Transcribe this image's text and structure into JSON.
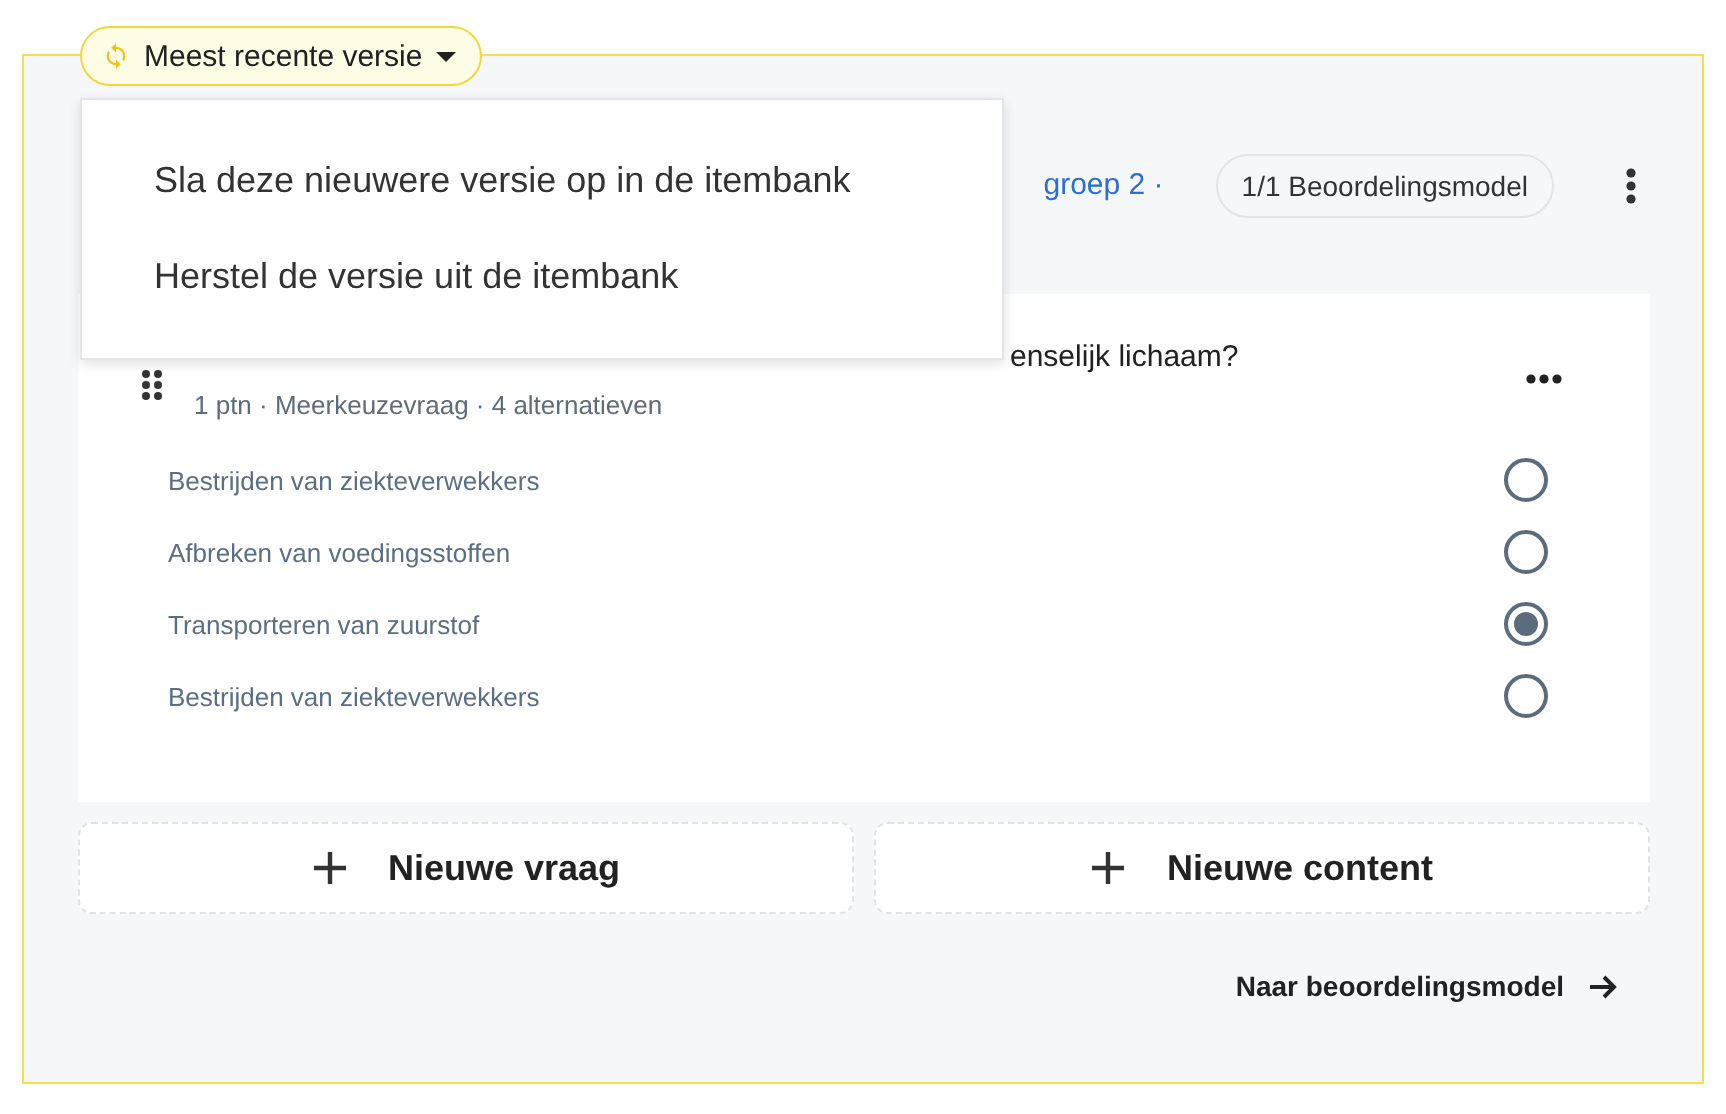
{
  "version_selector": {
    "label": "Meest recente versie",
    "open": true
  },
  "version_menu": {
    "items": [
      "Sla deze nieuwere versie op in de itembank",
      "Herstel de versie uit de itembank"
    ]
  },
  "header": {
    "breadcrumb": "groep 2 ·",
    "rubric_badge": "1/1 Beoordelingsmodel"
  },
  "question": {
    "text": "enselijk lichaam?",
    "meta": "1 ptn · Meerkeuzevraag · 4 alternatieven",
    "options": [
      {
        "label": "Bestrijden van ziekteverwekkers",
        "selected": false
      },
      {
        "label": "Afbreken van voedingsstoffen",
        "selected": false
      },
      {
        "label": "Transporteren van zuurstof",
        "selected": true
      },
      {
        "label": "Bestrijden van ziekteverwekkers",
        "selected": false
      }
    ]
  },
  "actions": [
    "Nieuwe vraag",
    "Nieuwe content"
  ],
  "footer_link": "Naar beoordelingsmodel"
}
